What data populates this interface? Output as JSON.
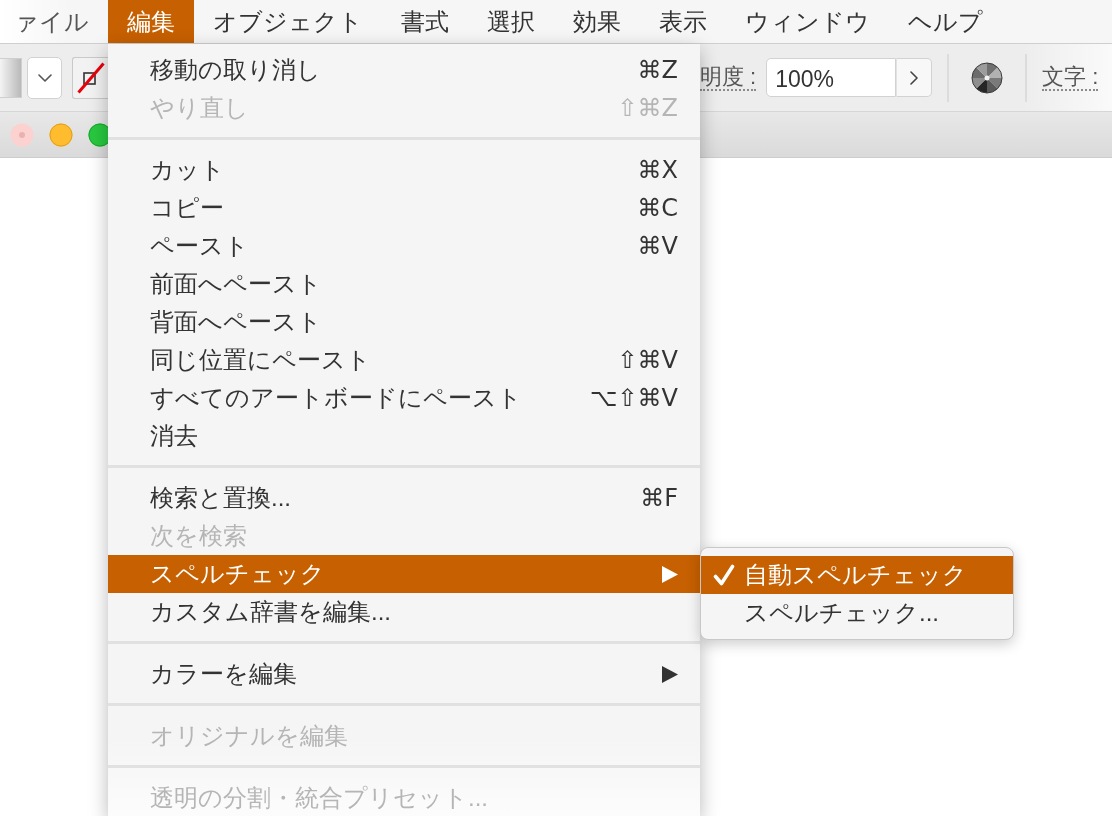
{
  "menu_bar": {
    "items": [
      {
        "label": "ァイル",
        "selected": false
      },
      {
        "label": "編集",
        "selected": true
      },
      {
        "label": "オブジェクト",
        "selected": false
      },
      {
        "label": "書式",
        "selected": false
      },
      {
        "label": "選択",
        "selected": false
      },
      {
        "label": "効果",
        "selected": false
      },
      {
        "label": "表示",
        "selected": false
      },
      {
        "label": "ウィンドウ",
        "selected": false
      },
      {
        "label": "ヘルプ",
        "selected": false
      }
    ]
  },
  "toolbar": {
    "field": {
      "label": "明度 :",
      "value": "100%"
    },
    "trailing_label": "文字 :"
  },
  "edit_menu": {
    "groups": [
      {
        "items": [
          {
            "label": "移動の取り消し",
            "shortcut": "⌘Z",
            "disabled": false,
            "highlighted": false,
            "has_submenu": false
          },
          {
            "label": "やり直し",
            "shortcut": "⇧⌘Z",
            "disabled": true,
            "highlighted": false,
            "has_submenu": false
          }
        ]
      },
      {
        "items": [
          {
            "label": "カット",
            "shortcut": "⌘X",
            "disabled": false,
            "highlighted": false,
            "has_submenu": false
          },
          {
            "label": "コピー",
            "shortcut": "⌘C",
            "disabled": false,
            "highlighted": false,
            "has_submenu": false
          },
          {
            "label": "ペースト",
            "shortcut": "⌘V",
            "disabled": false,
            "highlighted": false,
            "has_submenu": false
          },
          {
            "label": "前面へペースト",
            "disabled": false,
            "highlighted": false,
            "has_submenu": false
          },
          {
            "label": "背面へペースト",
            "disabled": false,
            "highlighted": false,
            "has_submenu": false
          },
          {
            "label": "同じ位置にペースト",
            "shortcut": "⇧⌘V",
            "disabled": false,
            "highlighted": false,
            "has_submenu": false
          },
          {
            "label": "すべてのアートボードにペースト",
            "shortcut": "⌥⇧⌘V",
            "disabled": false,
            "highlighted": false,
            "has_submenu": false
          },
          {
            "label": "消去",
            "disabled": false,
            "highlighted": false,
            "has_submenu": false
          }
        ]
      },
      {
        "items": [
          {
            "label": "検索と置換...",
            "shortcut": "⌘F",
            "disabled": false,
            "highlighted": false,
            "has_submenu": false
          },
          {
            "label": "次を検索",
            "disabled": true,
            "highlighted": false,
            "has_submenu": false
          },
          {
            "label": "スペルチェック",
            "disabled": false,
            "highlighted": true,
            "has_submenu": true
          },
          {
            "label": "カスタム辞書を編集...",
            "disabled": false,
            "highlighted": false,
            "has_submenu": false
          }
        ]
      },
      {
        "items": [
          {
            "label": "カラーを編集",
            "disabled": false,
            "highlighted": false,
            "has_submenu": true
          }
        ]
      },
      {
        "items": [
          {
            "label": "オリジナルを編集",
            "disabled": true,
            "highlighted": false,
            "has_submenu": false
          }
        ]
      },
      {
        "items": [
          {
            "label": "透明の分割・統合プリセット...",
            "disabled": true,
            "highlighted": false,
            "has_submenu": false
          }
        ]
      }
    ]
  },
  "submenu": {
    "items": [
      {
        "label": "自動スペルチェック",
        "checked": true,
        "highlighted": true
      },
      {
        "label": "スペルチェック...",
        "checked": false,
        "highlighted": false
      }
    ]
  }
}
